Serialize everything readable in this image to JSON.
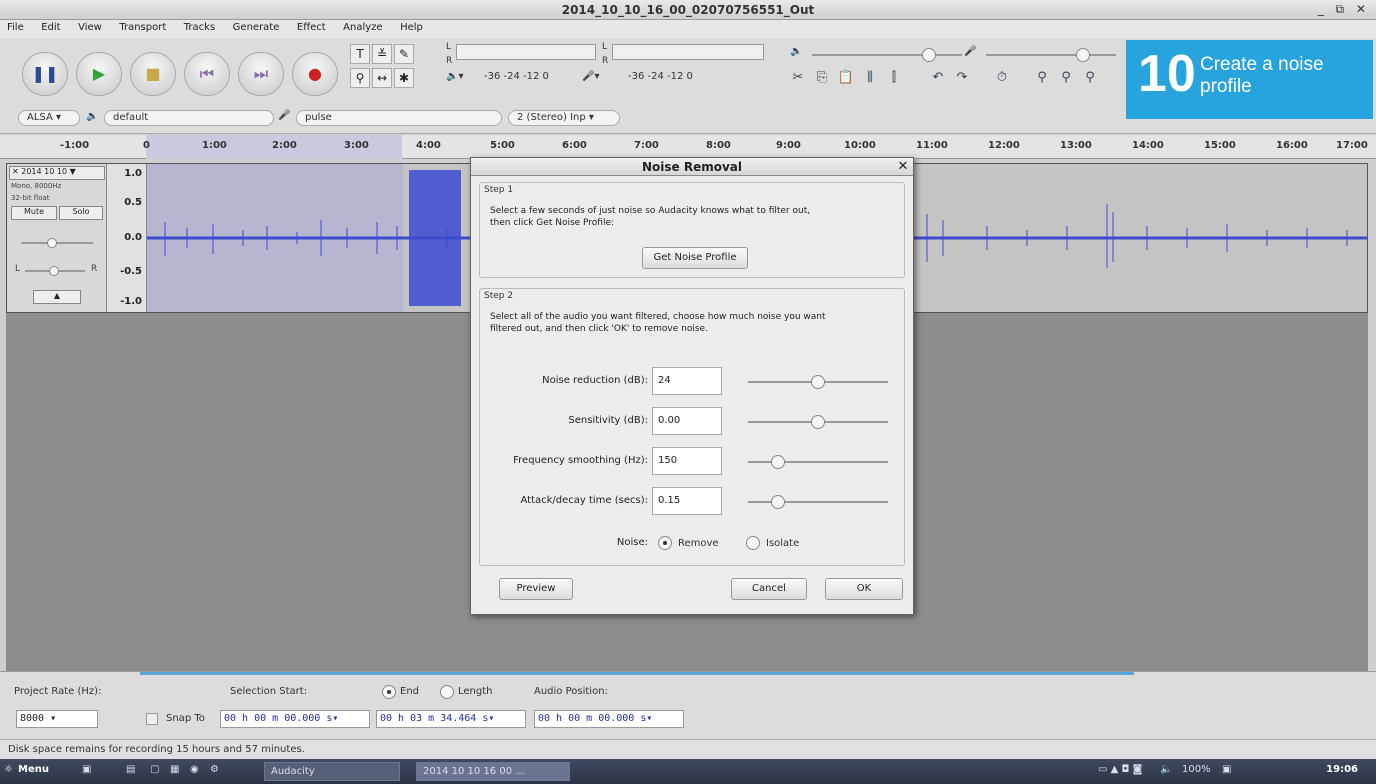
{
  "window": {
    "title": "2014_10_10_16_00_02070756551_Out",
    "controls": "_ ⧉ ✕"
  },
  "menu": [
    "File",
    "Edit",
    "View",
    "Transport",
    "Tracks",
    "Generate",
    "Effect",
    "Analyze",
    "Help"
  ],
  "meters": {
    "rec_scale": "-36 -24 -12 0",
    "play_scale": "-36 -24 -12 0",
    "left": "L",
    "right": "R"
  },
  "device_bar": {
    "host": "ALSA",
    "output": "default",
    "input": "pulse",
    "channels": "2 (Stereo) Inp"
  },
  "callout": {
    "number": "10",
    "text": "Create a noise profile"
  },
  "ruler_ticks": [
    "-1:00",
    "0",
    "1:00",
    "2:00",
    "3:00",
    "4:00",
    "5:00",
    "6:00",
    "7:00",
    "8:00",
    "9:00",
    "10:00",
    "11:00",
    "12:00",
    "13:00",
    "14:00",
    "15:00",
    "16:00",
    "17:00"
  ],
  "track": {
    "name": "2014 10 10",
    "meta1": "Mono, 8000Hz",
    "meta2": "32-bit float",
    "mute": "Mute",
    "solo": "Solo",
    "pan_l": "L",
    "pan_r": "R",
    "scale": [
      "1.0",
      "0.5",
      "0.0",
      "-0.5",
      "-1.0"
    ]
  },
  "dialog": {
    "title": "Noise Removal",
    "step1_label": "Step 1",
    "step1_text1": "Select a few seconds of just noise so Audacity knows what to filter out,",
    "step1_text2": "then click Get Noise Profile:",
    "get_profile": "Get Noise Profile",
    "step2_label": "Step 2",
    "step2_text1": "Select all of the audio you want filtered, choose how much noise you want",
    "step2_text2": "filtered out, and then click 'OK' to remove noise.",
    "fields": [
      {
        "label": "Noise reduction (dB):",
        "value": "24",
        "level": 0.5
      },
      {
        "label": "Sensitivity (dB):",
        "value": "0.00",
        "level": 0.5
      },
      {
        "label": "Frequency smoothing (Hz):",
        "value": "150",
        "level": 0.18
      },
      {
        "label": "Attack/decay time (secs):",
        "value": "0.15",
        "level": 0.18
      }
    ],
    "noise_label": "Noise:",
    "remove": "Remove",
    "isolate": "Isolate",
    "preview": "Preview",
    "cancel": "Cancel",
    "ok": "OK"
  },
  "selection_bar": {
    "project_rate_label": "Project Rate (Hz):",
    "project_rate": "8000",
    "selection_start_label": "Selection Start:",
    "end": "End",
    "length": "Length",
    "audio_position_label": "Audio Position:",
    "snap_to": "Snap To",
    "start_time": "00 h 00 m 00.000 s",
    "end_time": "00 h 03 m 34.464 s",
    "position_time": "00 h 00 m 00.000 s"
  },
  "status": "Disk space remains for recording 15 hours and 57 minutes.",
  "taskbar": {
    "menu": "Menu",
    "tasks": [
      "Audacity",
      "2014 10 10 16 00 ..."
    ],
    "zoom": "100%",
    "clock": "19:06"
  }
}
